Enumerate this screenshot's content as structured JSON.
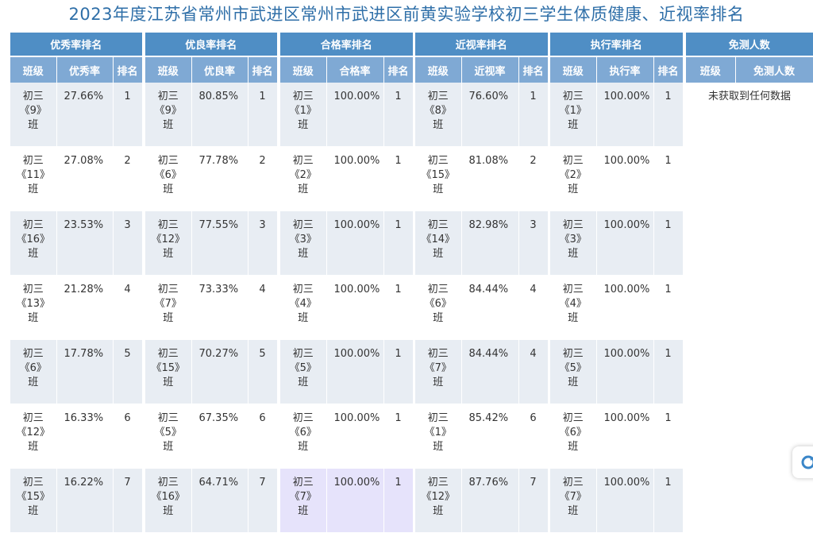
{
  "title": "2023年度江苏省常州市武进区常州市武进区前黄实验学校初三学生体质健康、近视率排名",
  "panels": [
    {
      "name": "优秀率排名",
      "cols": [
        "班级",
        "优秀率",
        "排名"
      ],
      "rows": [
        {
          "cls": [
            "初三",
            "《9》",
            "班"
          ],
          "val": "27.66%",
          "rank": "1"
        },
        {
          "cls": [
            "初三",
            "《11》",
            "班"
          ],
          "val": "27.08%",
          "rank": "2"
        },
        {
          "cls": [
            "初三",
            "《16》",
            "班"
          ],
          "val": "23.53%",
          "rank": "3"
        },
        {
          "cls": [
            "初三",
            "《13》",
            "班"
          ],
          "val": "21.28%",
          "rank": "4"
        },
        {
          "cls": [
            "初三",
            "《6》",
            "班"
          ],
          "val": "17.78%",
          "rank": "5"
        },
        {
          "cls": [
            "初三",
            "《12》",
            "班"
          ],
          "val": "16.33%",
          "rank": "6"
        },
        {
          "cls": [
            "初三",
            "《15》",
            "班"
          ],
          "val": "16.22%",
          "rank": "7"
        }
      ]
    },
    {
      "name": "优良率排名",
      "cols": [
        "班级",
        "优良率",
        "排名"
      ],
      "rows": [
        {
          "cls": [
            "初三",
            "《9》",
            "班"
          ],
          "val": "80.85%",
          "rank": "1"
        },
        {
          "cls": [
            "初三",
            "《6》",
            "班"
          ],
          "val": "77.78%",
          "rank": "2"
        },
        {
          "cls": [
            "初三",
            "《12》",
            "班"
          ],
          "val": "77.55%",
          "rank": "3"
        },
        {
          "cls": [
            "初三",
            "《7》",
            "班"
          ],
          "val": "73.33%",
          "rank": "4"
        },
        {
          "cls": [
            "初三",
            "《15》",
            "班"
          ],
          "val": "70.27%",
          "rank": "5"
        },
        {
          "cls": [
            "初三",
            "《5》",
            "班"
          ],
          "val": "67.35%",
          "rank": "6"
        },
        {
          "cls": [
            "初三",
            "《16》",
            "班"
          ],
          "val": "64.71%",
          "rank": "7"
        }
      ]
    },
    {
      "name": "合格率排名",
      "cols": [
        "班级",
        "合格率",
        "排名"
      ],
      "rows": [
        {
          "cls": [
            "初三",
            "《1》",
            "班"
          ],
          "val": "100.00%",
          "rank": "1"
        },
        {
          "cls": [
            "初三",
            "《2》",
            "班"
          ],
          "val": "100.00%",
          "rank": "1"
        },
        {
          "cls": [
            "初三",
            "《3》",
            "班"
          ],
          "val": "100.00%",
          "rank": "1"
        },
        {
          "cls": [
            "初三",
            "《4》",
            "班"
          ],
          "val": "100.00%",
          "rank": "1"
        },
        {
          "cls": [
            "初三",
            "《5》",
            "班"
          ],
          "val": "100.00%",
          "rank": "1"
        },
        {
          "cls": [
            "初三",
            "《6》",
            "班"
          ],
          "val": "100.00%",
          "rank": "1"
        },
        {
          "cls": [
            "初三",
            "《7》",
            "班"
          ],
          "val": "100.00%",
          "rank": "1",
          "highlight": true
        }
      ]
    },
    {
      "name": "近视率排名",
      "cols": [
        "班级",
        "近视率",
        "排名"
      ],
      "rows": [
        {
          "cls": [
            "初三",
            "《8》",
            "班"
          ],
          "val": "76.60%",
          "rank": "1"
        },
        {
          "cls": [
            "初三",
            "《15》",
            "班"
          ],
          "val": "81.08%",
          "rank": "2"
        },
        {
          "cls": [
            "初三",
            "《14》",
            "班"
          ],
          "val": "82.98%",
          "rank": "3"
        },
        {
          "cls": [
            "初三",
            "《6》",
            "班"
          ],
          "val": "84.44%",
          "rank": "4"
        },
        {
          "cls": [
            "初三",
            "《7》",
            "班"
          ],
          "val": "84.44%",
          "rank": "4"
        },
        {
          "cls": [
            "初三",
            "《1》",
            "班"
          ],
          "val": "85.42%",
          "rank": "6"
        },
        {
          "cls": [
            "初三",
            "《12》",
            "班"
          ],
          "val": "87.76%",
          "rank": "7"
        }
      ]
    },
    {
      "name": "执行率排名",
      "cols": [
        "班级",
        "执行率",
        "排名"
      ],
      "rows": [
        {
          "cls": [
            "初三",
            "《1》",
            "班"
          ],
          "val": "100.00%",
          "rank": "1"
        },
        {
          "cls": [
            "初三",
            "《2》",
            "班"
          ],
          "val": "100.00%",
          "rank": "1"
        },
        {
          "cls": [
            "初三",
            "《3》",
            "班"
          ],
          "val": "100.00%",
          "rank": "1"
        },
        {
          "cls": [
            "初三",
            "《4》",
            "班"
          ],
          "val": "100.00%",
          "rank": "1"
        },
        {
          "cls": [
            "初三",
            "《5》",
            "班"
          ],
          "val": "100.00%",
          "rank": "1"
        },
        {
          "cls": [
            "初三",
            "《6》",
            "班"
          ],
          "val": "100.00%",
          "rank": "1"
        },
        {
          "cls": [
            "初三",
            "《7》",
            "班"
          ],
          "val": "100.00%",
          "rank": "1"
        }
      ]
    }
  ],
  "exempt": {
    "name": "免测人数",
    "cols": [
      "班级",
      "免测人数"
    ],
    "empty_text": "未获取到任何数据"
  },
  "colors": {
    "title": "#2f6fa8",
    "header_dark": "#4f8ec5",
    "header_light": "#7fa9d4",
    "row_alt": "#e8edf3",
    "highlight": "#e6e3fb"
  },
  "float_button_icon": "refresh-icon"
}
